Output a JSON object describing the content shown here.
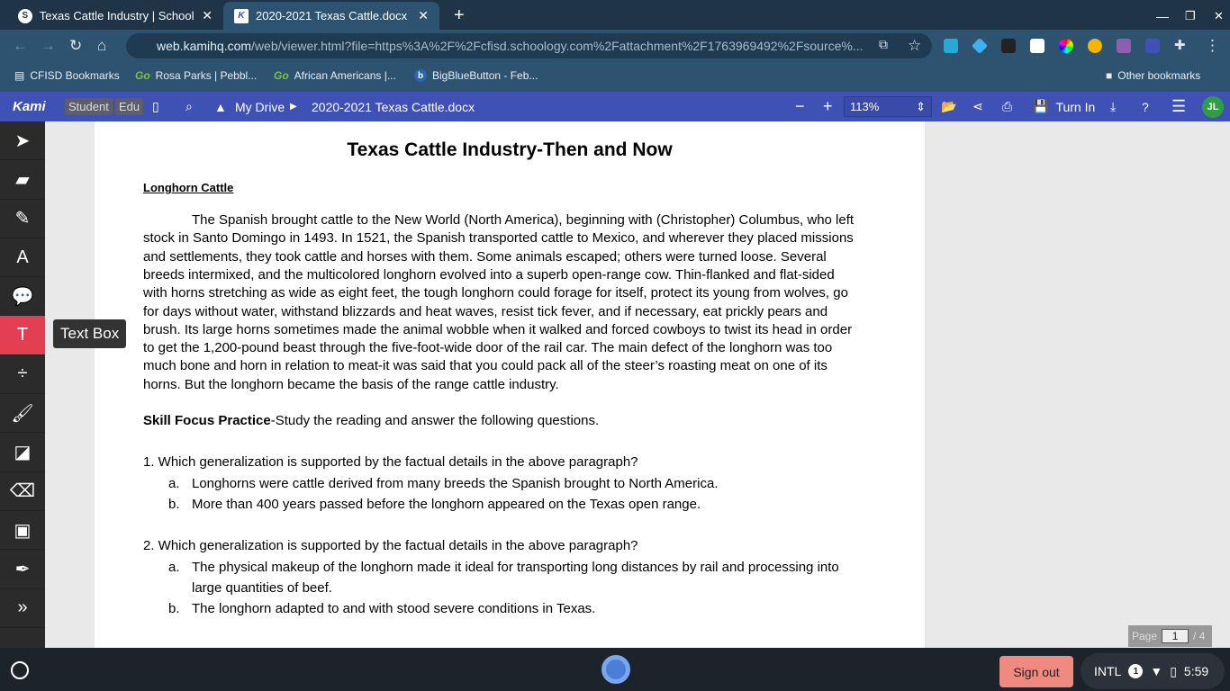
{
  "browser": {
    "tabs": [
      {
        "label": "Texas Cattle Industry | Schoolog",
        "icon": "schoology-icon"
      },
      {
        "label": "2020-2021 Texas Cattle.docx",
        "icon": "kami-icon"
      }
    ],
    "url": "web.kamihq.com",
    "url_rest": "/web/viewer.html?file=https%3A%2F%2Fcfisd.schoology.com%2Fattachment%2F1763969492%2Fsource%...",
    "bookmarks": [
      "CFISD Bookmarks",
      "Rosa Parks | Pebbl...",
      "African Americans |...",
      "BigBlueButton - Feb..."
    ],
    "go": "Go",
    "other_bookmarks": "Other bookmarks"
  },
  "kami": {
    "logo": "Kami",
    "student": "Student",
    "edu": "Edu",
    "drive": "My Drive",
    "file": "2020-2021 Texas Cattle.docx",
    "zoom": "113%",
    "turn_in": "Turn In",
    "avatar": "JL"
  },
  "tooltip": "Text Box",
  "doc": {
    "title": "Texas Cattle Industry-Then and Now",
    "heading": "Longhorn Cattle",
    "para": [
      "The Spanish brought cattle to the New World (North America), beginning with (Christopher) Columbus, who left",
      "stock in Santo Domingo in 1493.  In 1521, the Spanish transported cattle to Mexico, and wherever they placed missions",
      "and settlements, they took cattle and horses with them.  Some animals escaped; others were turned loose.  Several",
      "breeds intermixed, and the multicolored longhorn evolved into a superb open-range cow.  Thin-flanked and flat-sided",
      "with horns stretching as wide as eight feet, the tough longhorn could forage for itself, protect its young from wolves, go",
      "for days without water, withstand blizzards and heat waves, resist tick fever, and if necessary, eat prickly pears and",
      "brush.  Its large horns sometimes made the animal wobble when it walked and forced cowboys to twist its head in order",
      "to get the 1,200-pound beast through the five-foot-wide door of the rail car.  The main defect of the longhorn was too",
      "much bone and horn in relation to meat-it was said that you could pack all of the steer’s roasting meat on one of its",
      "horns.  But the longhorn became the basis of the range cattle industry."
    ],
    "skill_bold": "Skill Focus Practice",
    "skill_rest": "-Study the reading and answer the following questions.",
    "q1": "1.  Which generalization is supported by the factual details in the above paragraph?",
    "q1a": "Longhorns were cattle derived from many breeds the Spanish brought to North America.",
    "q1b": "More than 400 years passed before the longhorn appeared on the Texas open range.",
    "q2": "2.  Which generalization is supported by the factual details in the above paragraph?",
    "q2a1": "The physical makeup of the longhorn made it ideal for transporting long distances by rail and processing into",
    "q2a2": "large quantities of beef.",
    "q2b": "The longhorn adapted to and with stood severe conditions in Texas.",
    "a": "a.",
    "b": "b."
  },
  "pager": {
    "label": "Page",
    "current": "1",
    "total": "/ 4"
  },
  "shelf": {
    "sign_out": "Sign out",
    "ime": "INTL",
    "notif": "1",
    "time": "5:59"
  }
}
